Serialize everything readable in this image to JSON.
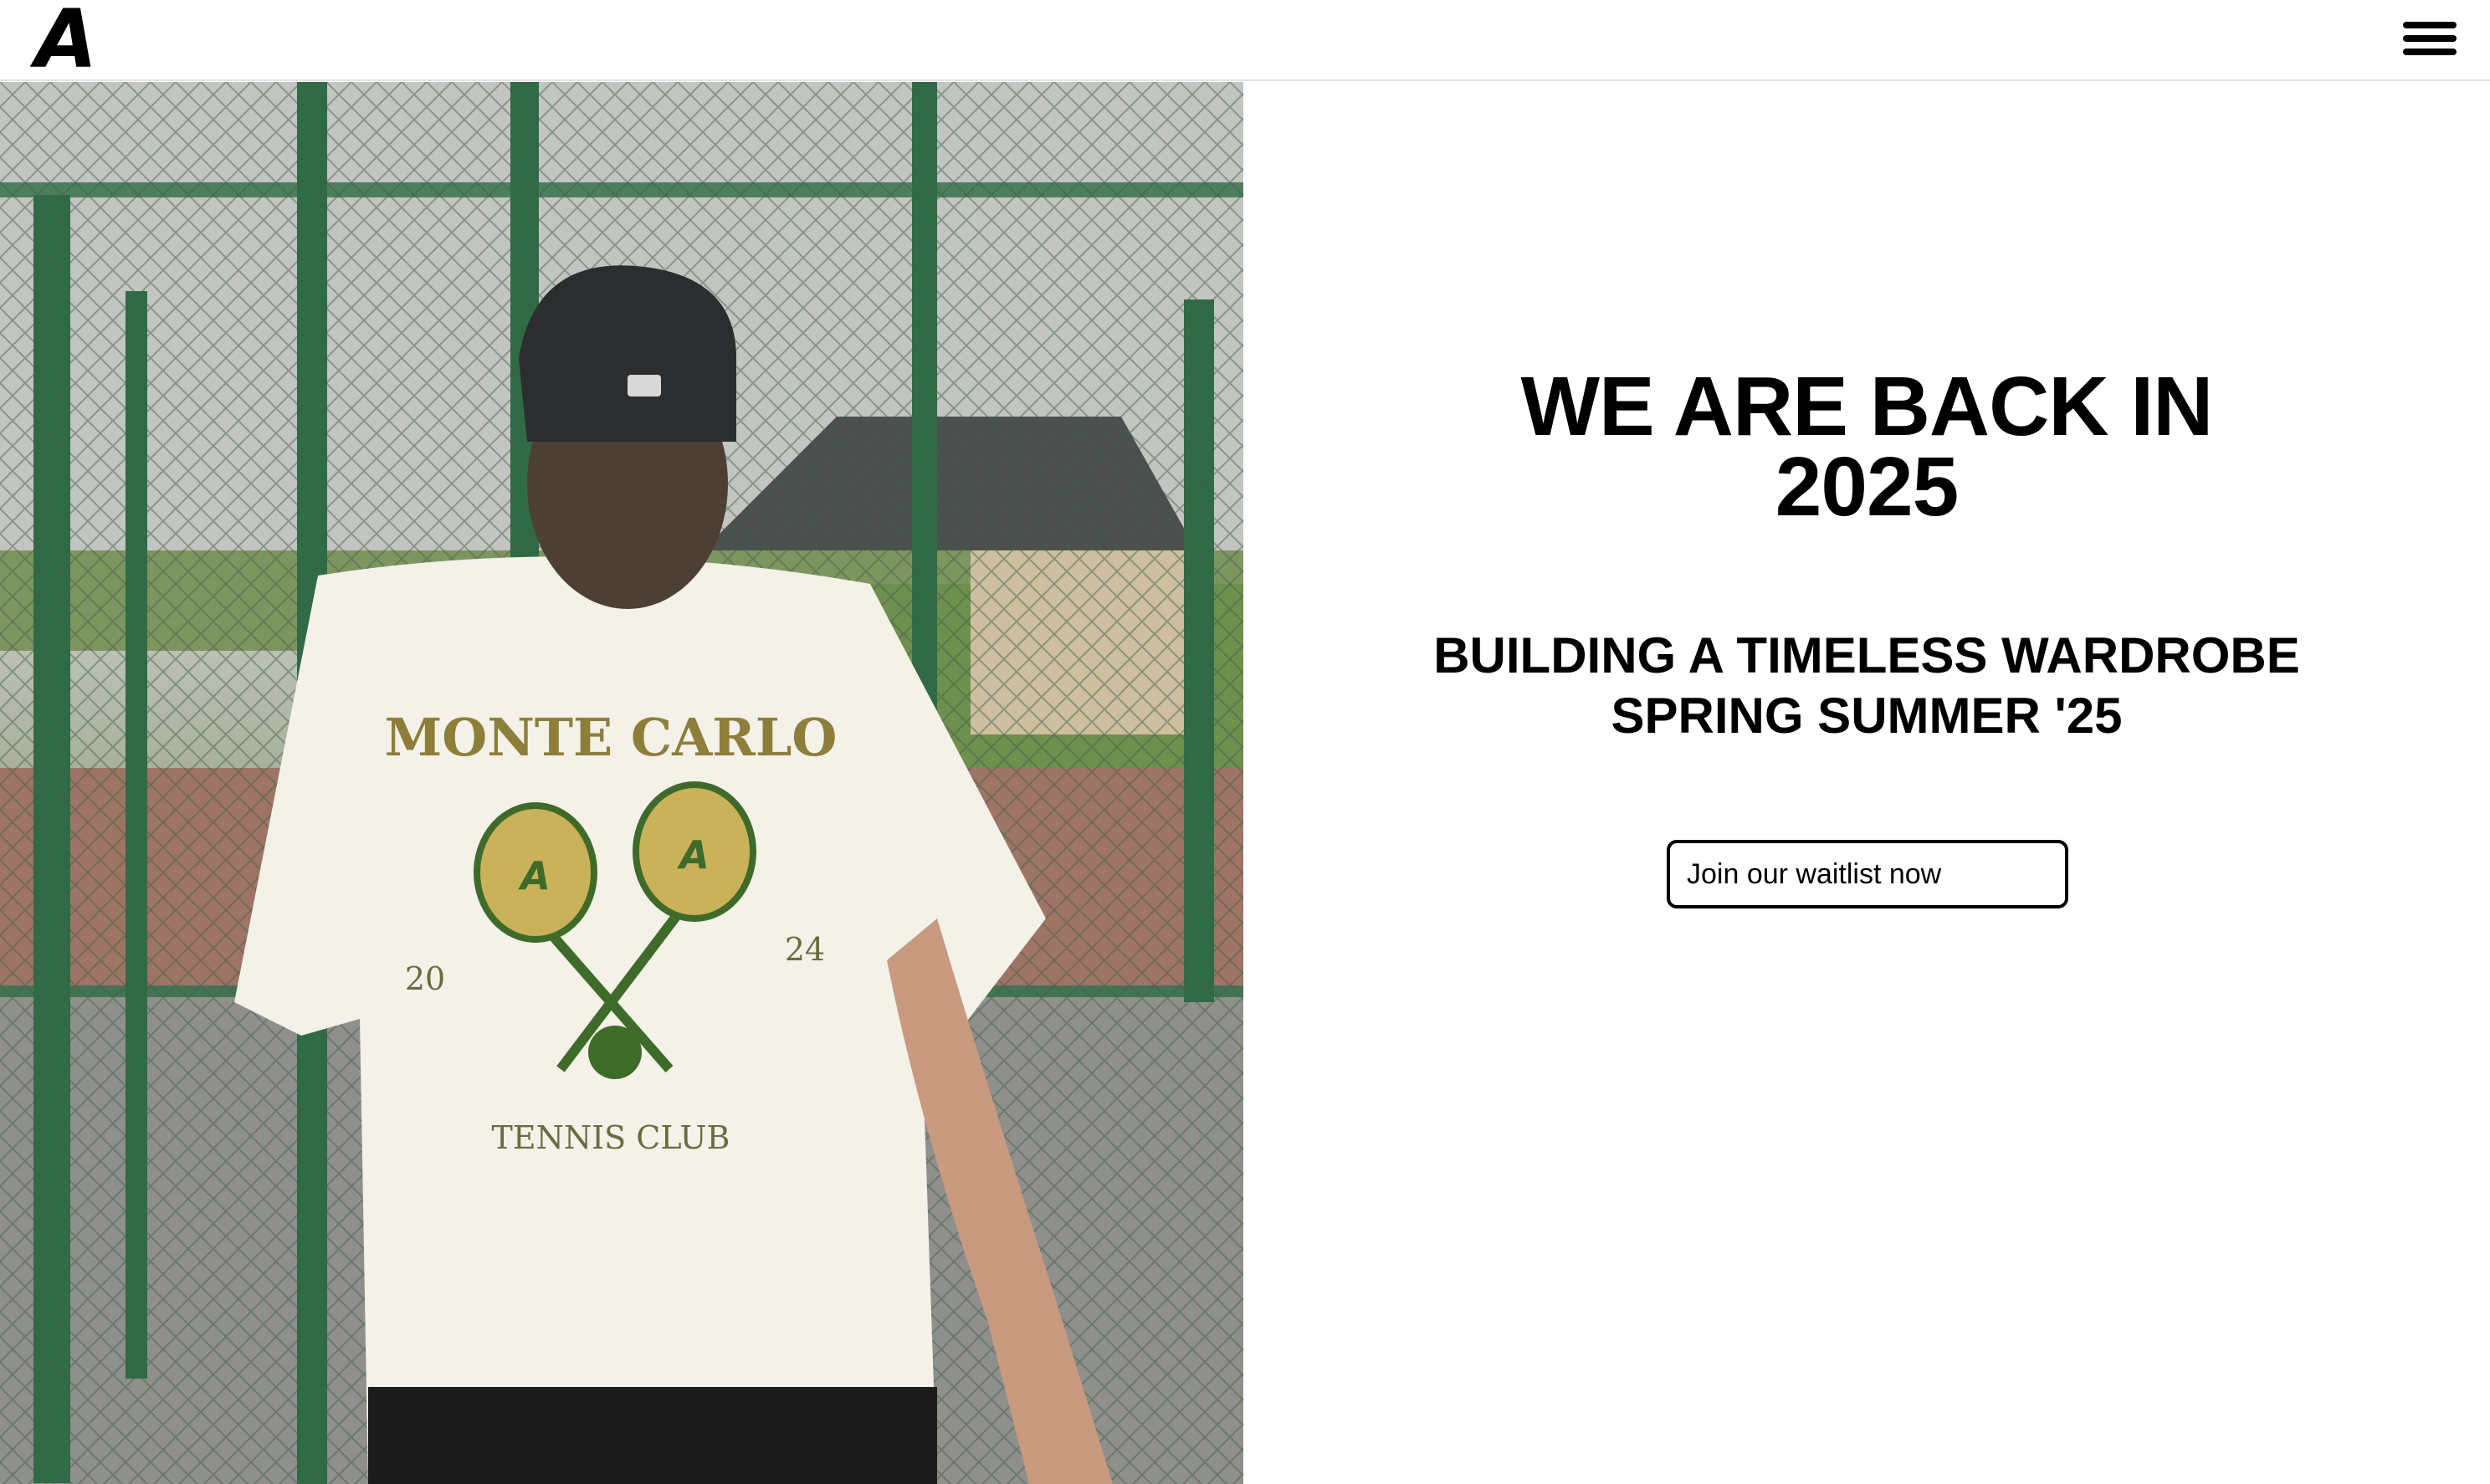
{
  "header": {
    "logo_text": "A",
    "menu_icon": "hamburger-menu-icon"
  },
  "hero_image": {
    "shirt_text_top": "MONTE CARLO",
    "shirt_text_bottom": "TENNIS CLUB",
    "shirt_year_left": "20",
    "shirt_year_right": "24",
    "racket_letter": "A"
  },
  "main": {
    "headline_line1": "WE ARE BACK IN",
    "headline_line2": "2025",
    "subhead_line1": "BUILDING A TIMELESS WARDROBE",
    "subhead_line2": "SPRING SUMMER '25",
    "waitlist": {
      "placeholder": "Join our waitlist now",
      "submit_symbol": "→"
    }
  },
  "colors": {
    "fence_green": "#2f6b45",
    "shirt_white": "#f3f1e8",
    "print_green": "#3f6b2a",
    "print_gold": "#c9b25a"
  }
}
